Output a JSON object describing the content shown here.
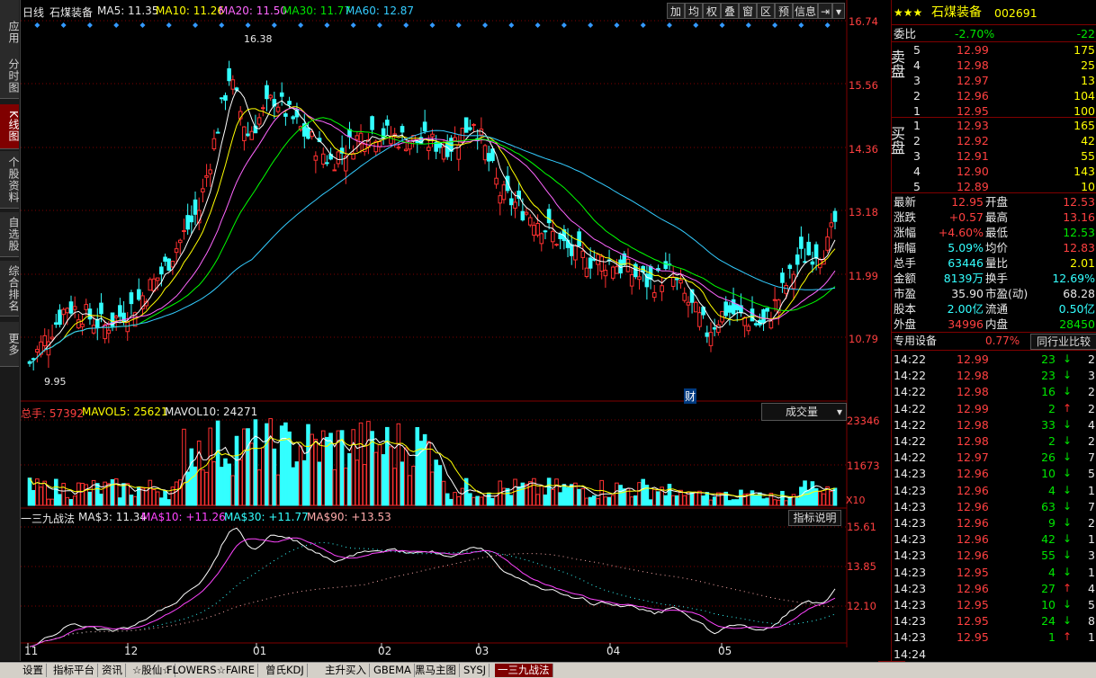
{
  "left_nav": [
    {
      "label": "应用",
      "active": false
    },
    {
      "label": "分时图",
      "active": false
    },
    {
      "label": "K线图",
      "active": true
    },
    {
      "label": "个股资料",
      "active": false
    },
    {
      "label": "自选股",
      "active": false
    },
    {
      "label": "综合排名",
      "active": false
    },
    {
      "label": "更多",
      "active": false
    }
  ],
  "header": {
    "period": "日线",
    "stock_name": "石煤装备",
    "ma5": "MA5: 11.35",
    "ma10": "MA10: 11.26",
    "ma20": "MA20: 11.50",
    "ma30": "MA30: 11.77",
    "ma60": "MA60: 12.87"
  },
  "toolbar": [
    "加",
    "均",
    "权",
    "叠",
    "窗",
    "区",
    "预",
    "信息"
  ],
  "price_axis": [
    "16.74",
    "15.56",
    "14.36",
    "13.18",
    "11.99",
    "10.79"
  ],
  "annotations": {
    "high": "16.38",
    "low": "9.95",
    "fin": "财"
  },
  "volume_header": {
    "total": "总手: 57392",
    "mavol5": "MAVOL5: 25621",
    "mavol10": "MAVOL10: 24271",
    "selector": "成交量",
    "axis": [
      "23346",
      "11673"
    ],
    "scale": "X10"
  },
  "indicator_header": {
    "name": "一三九战法",
    "ma3": "MA$3: 11.34",
    "ma10": "MA$10: +11.26",
    "ma30": "MA$30: +11.77",
    "ma90": "MA$90: +13.53",
    "help": "指标说明",
    "axis": [
      "15.61",
      "13.85",
      "12.10"
    ]
  },
  "months": [
    "11",
    "12",
    "01",
    "02",
    "03",
    "04",
    "05"
  ],
  "right_panel": {
    "title": "石煤装备",
    "code": "002691",
    "weibi_label": "委比",
    "weibi_pct": "-2.70%",
    "weibi_diff": "-22",
    "sell_label": "卖盘",
    "buy_label": "买盘",
    "sell": [
      {
        "lvl": "5",
        "price": "12.99",
        "vol": "175"
      },
      {
        "lvl": "4",
        "price": "12.98",
        "vol": "25"
      },
      {
        "lvl": "3",
        "price": "12.97",
        "vol": "13"
      },
      {
        "lvl": "2",
        "price": "12.96",
        "vol": "104"
      },
      {
        "lvl": "1",
        "price": "12.95",
        "vol": "100"
      }
    ],
    "buy": [
      {
        "lvl": "1",
        "price": "12.93",
        "vol": "165"
      },
      {
        "lvl": "2",
        "price": "12.92",
        "vol": "42"
      },
      {
        "lvl": "3",
        "price": "12.91",
        "vol": "55"
      },
      {
        "lvl": "4",
        "price": "12.90",
        "vol": "143"
      },
      {
        "lvl": "5",
        "price": "12.89",
        "vol": "10"
      }
    ],
    "quote": [
      {
        "l1": "最新",
        "v1": "12.95",
        "l2": "开盘",
        "v2": "12.53"
      },
      {
        "l1": "涨跌",
        "v1": "+0.57",
        "l2": "最高",
        "v2": "13.16"
      },
      {
        "l1": "涨幅",
        "v1": "+4.60%",
        "l2": "最低",
        "v2": "12.53"
      },
      {
        "l1": "振幅",
        "v1": "5.09%",
        "l2": "均价",
        "v2": "12.83"
      },
      {
        "l1": "总手",
        "v1": "63446",
        "l2": "量比",
        "v2": "2.01"
      },
      {
        "l1": "金额",
        "v1": "8139万",
        "l2": "换手",
        "v2": "12.69%"
      },
      {
        "l1": "市盈",
        "v1": "35.90",
        "l2": "市盈(动)",
        "v2": "68.28"
      },
      {
        "l1": "股本",
        "v1": "2.00亿",
        "l2": "流通",
        "v2": "0.50亿"
      },
      {
        "l1": "外盘",
        "v1": "34996",
        "l2": "内盘",
        "v2": "28450"
      }
    ],
    "sector_label": "专用设备",
    "sector_pct": "0.77%",
    "compare_btn": "同行业比较",
    "ticks": [
      {
        "t": "14:22",
        "p": "12.99",
        "v": "23",
        "d": "down",
        "n": "2"
      },
      {
        "t": "14:22",
        "p": "12.98",
        "v": "23",
        "d": "down",
        "n": "3"
      },
      {
        "t": "14:22",
        "p": "12.98",
        "v": "16",
        "d": "down",
        "n": "2"
      },
      {
        "t": "14:22",
        "p": "12.99",
        "v": "2",
        "d": "up",
        "n": "2"
      },
      {
        "t": "14:22",
        "p": "12.98",
        "v": "33",
        "d": "down",
        "n": "4"
      },
      {
        "t": "14:22",
        "p": "12.98",
        "v": "2",
        "d": "down",
        "n": "2"
      },
      {
        "t": "14:22",
        "p": "12.97",
        "v": "26",
        "d": "down",
        "n": "7"
      },
      {
        "t": "14:23",
        "p": "12.96",
        "v": "10",
        "d": "down",
        "n": "5"
      },
      {
        "t": "14:23",
        "p": "12.96",
        "v": "4",
        "d": "down",
        "n": "1"
      },
      {
        "t": "14:23",
        "p": "12.96",
        "v": "63",
        "d": "down",
        "n": "7"
      },
      {
        "t": "14:23",
        "p": "12.96",
        "v": "9",
        "d": "down",
        "n": "2"
      },
      {
        "t": "14:23",
        "p": "12.96",
        "v": "42",
        "d": "down",
        "n": "1"
      },
      {
        "t": "14:23",
        "p": "12.96",
        "v": "55",
        "d": "down",
        "n": "3"
      },
      {
        "t": "14:23",
        "p": "12.95",
        "v": "4",
        "d": "down",
        "n": "1"
      },
      {
        "t": "14:23",
        "p": "12.96",
        "v": "27",
        "d": "up",
        "n": "4"
      },
      {
        "t": "14:23",
        "p": "12.95",
        "v": "10",
        "d": "down",
        "n": "5"
      },
      {
        "t": "14:23",
        "p": "12.95",
        "v": "24",
        "d": "down",
        "n": "8"
      },
      {
        "t": "14:23",
        "p": "12.95",
        "v": "1",
        "d": "up",
        "n": "1"
      },
      {
        "t": "14:24",
        "p": "",
        "v": "",
        "d": "",
        "n": ""
      }
    ],
    "bottom_btn": "细"
  },
  "bottom_tabs": [
    "设置",
    "指标平台",
    "资讯",
    "☆股仙☆",
    "FLOWERS☆FAIRE",
    "曾氏KDJ",
    "主升买入",
    "GBEMA",
    "黑马主图",
    "SYSJ",
    "一三九战法"
  ],
  "active_tab": "一三九战法",
  "colors": {
    "up": "#ff3030",
    "down": "#33ffff",
    "ma5": "#ffffff",
    "ma10": "#ffff00",
    "ma20": "#ff66ff",
    "ma30": "#00ff00",
    "ma60": "#33ccff",
    "grid": "#800000"
  }
}
